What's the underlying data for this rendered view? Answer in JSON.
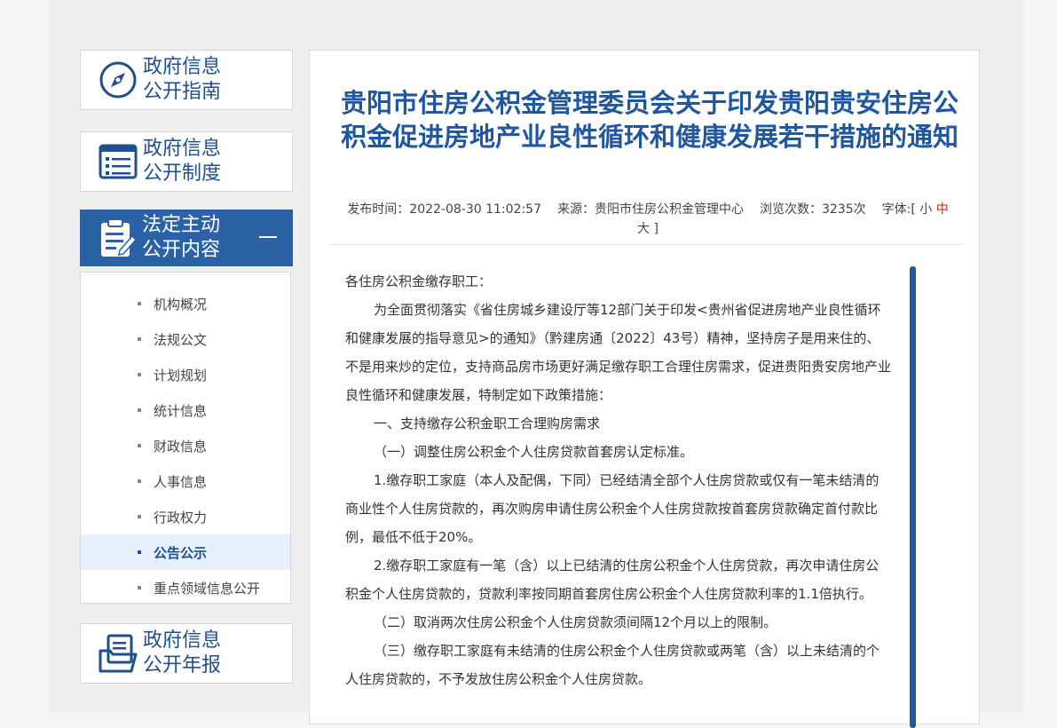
{
  "sidebar": {
    "guide": {
      "label": "政府信息\n公开指南",
      "icon": "compass-icon"
    },
    "system": {
      "label": "政府信息\n公开制度",
      "icon": "list-icon"
    },
    "active": {
      "label": "法定主动\n公开内容",
      "icon": "clipboard-edit-icon",
      "toggle": "collapse-icon"
    },
    "items": [
      {
        "label": "机构概况"
      },
      {
        "label": "法规公文"
      },
      {
        "label": "计划规划"
      },
      {
        "label": "统计信息"
      },
      {
        "label": "财政信息"
      },
      {
        "label": "人事信息"
      },
      {
        "label": "行政权力"
      },
      {
        "label": "公告公示",
        "active": true
      },
      {
        "label": "重点领域信息公开"
      }
    ],
    "annual": {
      "label": "政府信息\n公开年报",
      "icon": "folder-icon"
    }
  },
  "article": {
    "title": "贵阳市住房公积金管理委员会关于印发贵阳贵安住房公积金促进房地产业良性循环和健康发展若干措施的通知",
    "meta": {
      "publish_label": "发布时间：",
      "publish_time": "2022-08-30 11:02:57",
      "source_label": "来源：",
      "source": "贵阳市住房公积金管理中心",
      "views_label": "浏览次数：",
      "views": "3235次",
      "font_label": "字体:[",
      "font_small": "小",
      "font_mid": "中",
      "font_big": "大",
      "font_close": "]"
    },
    "paragraphs": [
      "各住房公积金缴存职工：",
      "为全面贯彻落实《省住房城乡建设厅等12部门关于印发<贵州省促进房地产业良性循环和健康发展的指导意见>的通知》（黔建房通〔2022〕43号）精神，坚持房子是用来住的、不是用来炒的定位，支持商品房市场更好满足缴存职工合理住房需求，促进贵阳贵安房地产业良性循环和健康发展，特制定如下政策措施：",
      "一、支持缴存公积金职工合理购房需求",
      "（一）调整住房公积金个人住房贷款首套房认定标准。",
      "1.缴存职工家庭（本人及配偶，下同）已经结清全部个人住房贷款或仅有一笔未结清的商业性个人住房贷款的，再次购房申请住房公积金个人住房贷款按首套房贷款确定首付款比例，最低不低于20%。",
      "2.缴存职工家庭有一笔（含）以上已结清的住房公积金个人住房贷款，再次申请住房公积金个人住房贷款的，贷款利率按同期首套房住房公积金个人住房贷款利率的1.1倍执行。",
      "（二）取消两次住房公积金个人住房贷款须间隔12个月以上的限制。",
      "（三）缴存职工家庭有未结清的住房公积金个人住房贷款或两笔（含）以上未结清的个人住房贷款的，不予发放住房公积金个人住房贷款。"
    ]
  },
  "colors": {
    "brand": "#1f57a0",
    "active_bg": "#2b62a5",
    "accent_red": "#d81e06"
  }
}
